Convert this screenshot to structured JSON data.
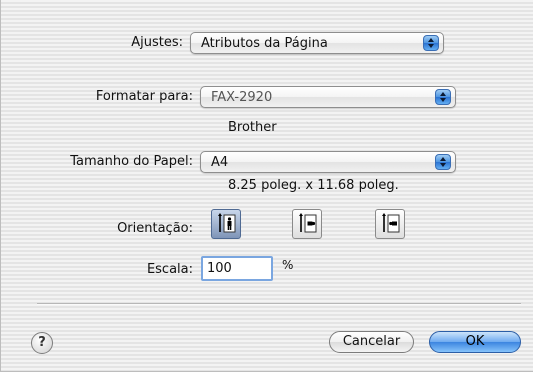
{
  "settings": {
    "label": "Ajustes:",
    "value": "Atributos da Página"
  },
  "format_for": {
    "label": "Formatar para:",
    "value": "FAX-2920",
    "vendor": "Brother"
  },
  "paper_size": {
    "label": "Tamanho do Papel:",
    "value": "A4",
    "dimensions": "8.25 poleg. x 11.68 poleg."
  },
  "orientation": {
    "label": "Orientação:",
    "options": [
      {
        "icon": "portrait-orientation-icon",
        "selected": true
      },
      {
        "icon": "landscape-orientation-icon",
        "selected": false
      },
      {
        "icon": "reverse-landscape-orientation-icon",
        "selected": false
      }
    ]
  },
  "scale": {
    "label": "Escala:",
    "value": "100",
    "unit": "%"
  },
  "help": {
    "glyph": "?"
  },
  "buttons": {
    "cancel": "Cancelar",
    "ok": "OK"
  },
  "colors": {
    "accent": "#3c85e0",
    "selection": "#7f95b8"
  }
}
